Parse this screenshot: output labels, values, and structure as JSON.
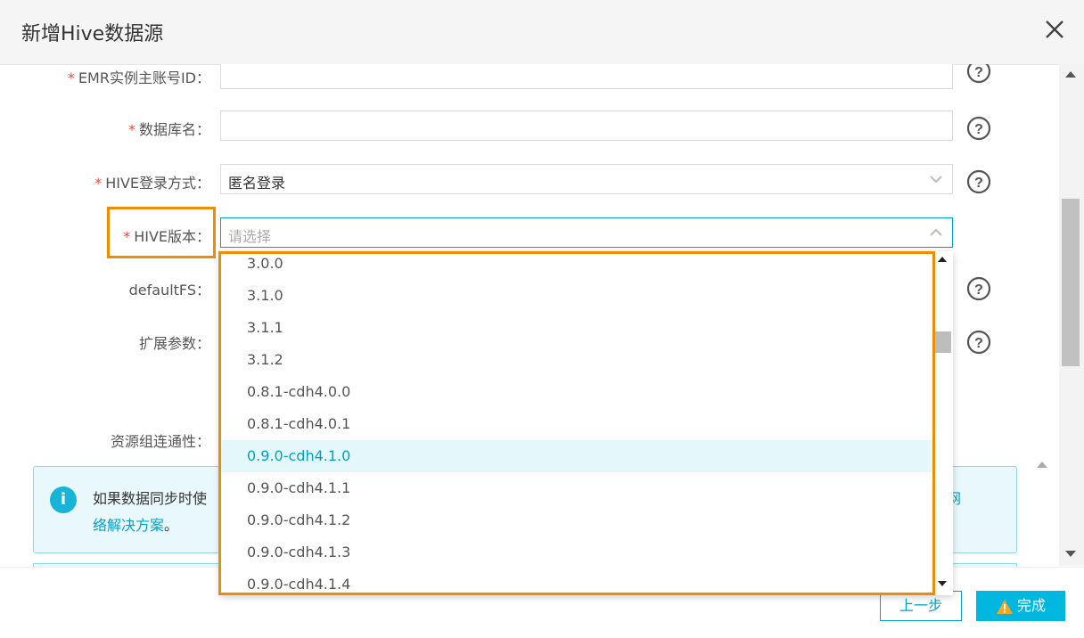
{
  "dialog": {
    "title": "新增Hive数据源"
  },
  "form": {
    "fields": [
      {
        "label": "EMR实例主账号ID：",
        "required": true,
        "value": ""
      },
      {
        "label": "数据库名：",
        "required": true,
        "value": ""
      },
      {
        "label": "HIVE登录方式：",
        "required": true,
        "value": "匿名登录"
      },
      {
        "label": "HIVE版本：",
        "required": true,
        "placeholder": "请选择"
      },
      {
        "label": "defaultFS：",
        "required": false
      },
      {
        "label": "扩展参数：",
        "required": false
      },
      {
        "label": "资源组连通性：",
        "required": false
      }
    ],
    "required_mark": "*"
  },
  "dropdown": {
    "options": [
      "3.0.0",
      "3.1.0",
      "3.1.1",
      "3.1.2",
      "0.8.1-cdh4.0.0",
      "0.8.1-cdh4.0.1",
      "0.9.0-cdh4.1.0",
      "0.9.0-cdh4.1.1",
      "0.9.0-cdh4.1.2",
      "0.9.0-cdh4.1.3",
      "0.9.0-cdh4.1.4"
    ],
    "highlighted": "0.9.0-cdh4.1.0"
  },
  "info": {
    "text_line1": "如果数据同步时使",
    "text_line2_link": "络解决方案",
    "text_line2_suffix": "。",
    "trailing_link": "网",
    "icon": "i"
  },
  "footer": {
    "prev_label": "上一步",
    "done_label": "完成"
  },
  "colors": {
    "accent": "#00a3c8",
    "highlight_box": "#f08c00",
    "required": "#e74c3c"
  }
}
